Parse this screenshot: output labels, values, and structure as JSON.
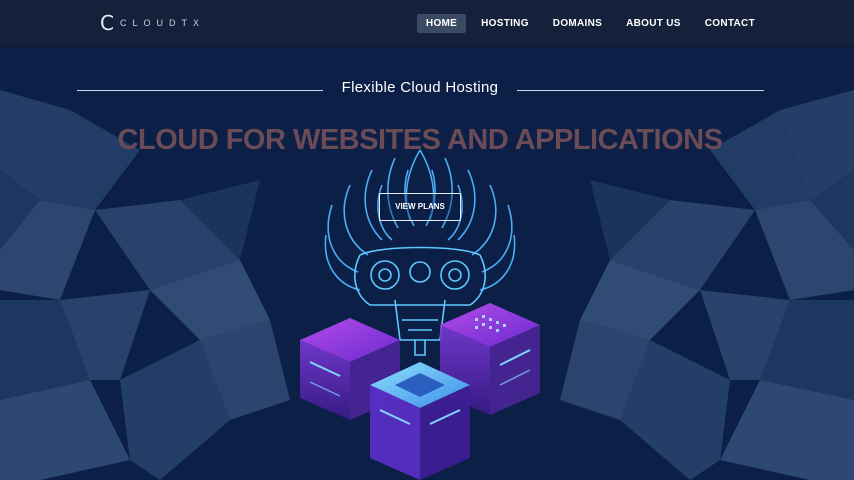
{
  "nav": {
    "logo_mark": "C",
    "logo_text": "CLOUDTX",
    "items": [
      {
        "label": "HOME",
        "active": true
      },
      {
        "label": "HOSTING",
        "active": false
      },
      {
        "label": "DOMAINS",
        "active": false
      },
      {
        "label": "ABOUT US",
        "active": false
      },
      {
        "label": "CONTACT",
        "active": false
      }
    ]
  },
  "hero": {
    "subtitle": "Flexible Cloud Hosting",
    "headline": "CLOUD FOR WEBSITES AND APPLICATIONS",
    "button_label": "VIEW PLANS"
  },
  "colors": {
    "background": "#0b1f47",
    "nav_bg": "#15213a",
    "headline": "#6b4b55",
    "accent_purple": "#9b3fd6",
    "accent_cyan": "#5fc8ff"
  },
  "icons": [
    "cloud-logo-icon",
    "mask-illustration",
    "server-stack-illustration"
  ]
}
